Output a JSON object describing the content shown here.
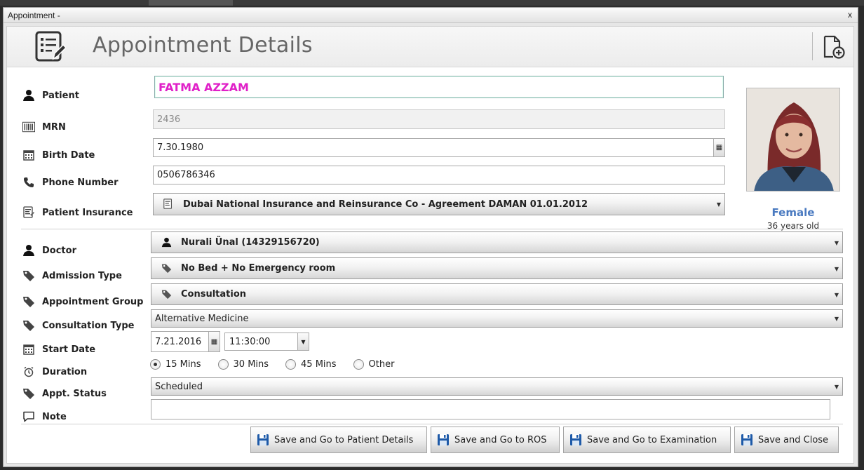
{
  "window": {
    "title": "Appointment -",
    "close_label": "x"
  },
  "header": {
    "title": "Appointment Details"
  },
  "patient": {
    "label": "Patient",
    "value": "FATMA AZZAM",
    "mrn_label": "MRN",
    "mrn_value": "2436",
    "birth_label": "Birth Date",
    "birth_value": "7.30.1980",
    "phone_label": "Phone Number",
    "phone_value": "0506786346",
    "insurance_label": "Patient Insurance",
    "insurance_value": "Dubai National Insurance and Reinsurance Co - Agreement DAMAN 01.01.2012",
    "gender": "Female",
    "age": "36 years  old"
  },
  "appointment": {
    "doctor_label": "Doctor",
    "doctor_value": "Nurali Ünal (14329156720)",
    "admission_label": "Admission Type",
    "admission_value": "No Bed + No Emergency room",
    "group_label": "Appointment Group",
    "group_value": "Consultation",
    "consult_label": "Consultation Type",
    "consult_value": "Alternative Medicine",
    "start_label": "Start Date",
    "start_date": "7.21.2016",
    "start_time": "11:30:00",
    "duration_label": "Duration",
    "durations": [
      "15 Mins",
      "30 Mins",
      "45 Mins",
      "Other"
    ],
    "duration_selected": "15 Mins",
    "status_label": "Appt. Status",
    "status_value": "Scheduled",
    "note_label": "Note",
    "note_value": ""
  },
  "buttons": {
    "patient_details": "Save and Go to Patient Details",
    "ros": "Save and Go to ROS",
    "examination": "Save and Go to Examination",
    "close": "Save and Close"
  },
  "colors": {
    "patient_name": "#e020c8",
    "gender": "#4a7ac0",
    "save_icon": "#1e5aa8"
  }
}
